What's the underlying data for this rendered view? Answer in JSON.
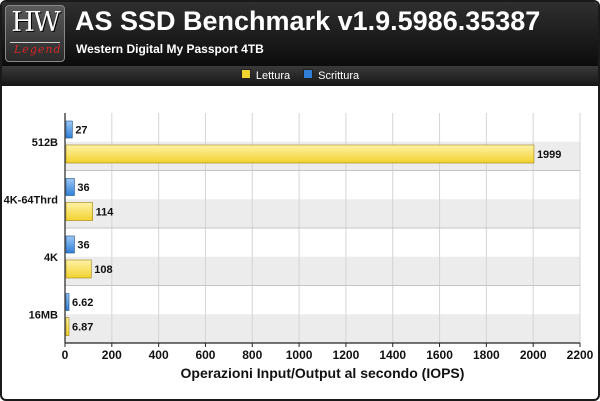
{
  "header": {
    "logo_main": "HW",
    "logo_sub": "Legend",
    "title": "AS SSD Benchmark v1.9.5986.35387",
    "subtitle": "Western Digital My Passport 4TB"
  },
  "colors": {
    "lettura": "#f1d22e",
    "scrittura": "#2f7fd6",
    "band": "#ececec"
  },
  "chart_data": {
    "type": "bar",
    "orientation": "horizontal",
    "categories": [
      "512B",
      "4K-64Thrd",
      "4K",
      "16MB"
    ],
    "series": [
      {
        "name": "Lettura",
        "values": [
          1999,
          114,
          108,
          6.87
        ],
        "labels": [
          "1999",
          "114",
          "108",
          "6.87"
        ]
      },
      {
        "name": "Scrittura",
        "values": [
          27,
          36,
          36,
          6.62
        ],
        "labels": [
          "27",
          "36",
          "36",
          "6.62"
        ]
      }
    ],
    "xlabel": "Operazioni Input/Output al secondo (IOPS)",
    "ylabel": "",
    "xlim": [
      0,
      2200
    ],
    "xticks": [
      0,
      200,
      400,
      600,
      800,
      1000,
      1200,
      1400,
      1600,
      1800,
      2000,
      2200
    ],
    "legend_position": "top",
    "grid": true
  }
}
